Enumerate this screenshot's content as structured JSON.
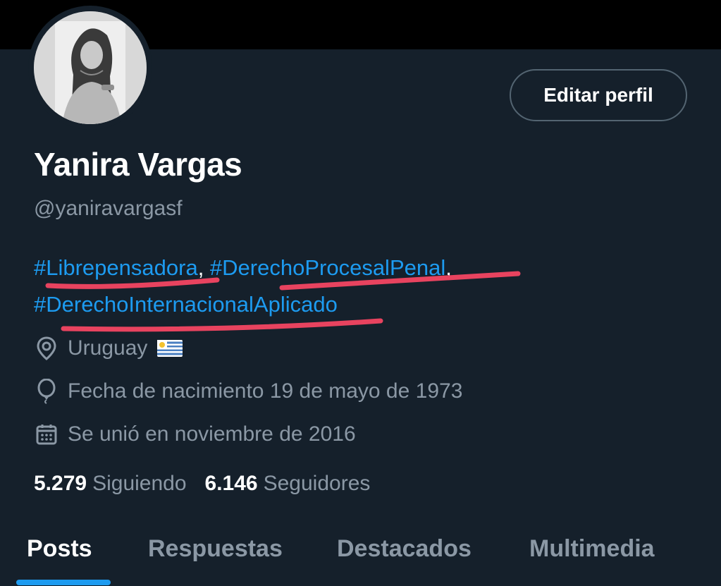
{
  "profile": {
    "name": "Yanira Vargas",
    "handle": "@yaniravargasf",
    "edit_label": "Editar perfil",
    "avatar_icon": "profile-photo",
    "bio": {
      "tag1": "#Librepensadora",
      "sep1": ", ",
      "tag2": "#DerechoProcesalPenal",
      "sep2": ",",
      "tag3": "#DerechoInternacionalAplicado"
    },
    "location": "Uruguay",
    "location_icon": "location-pin-icon",
    "flag_icon": "uruguay-flag-icon",
    "birthday": "Fecha de nacimiento 19 de mayo de 1973",
    "birthday_icon": "balloon-icon",
    "joined": "Se unió en noviembre de 2016",
    "joined_icon": "calendar-icon",
    "following_count": "5.279",
    "following_label": "Siguiendo",
    "followers_count": "6.146",
    "followers_label": "Seguidores"
  },
  "tabs": [
    {
      "label": "Posts",
      "active": true
    },
    {
      "label": "Respuestas",
      "active": false
    },
    {
      "label": "Destacados",
      "active": false
    },
    {
      "label": "Multimedia",
      "active": false
    }
  ],
  "colors": {
    "background": "#15202b",
    "accent": "#1d9bf0",
    "secondary_text": "#8b98a5",
    "annotation_underline": "#e8435f"
  }
}
